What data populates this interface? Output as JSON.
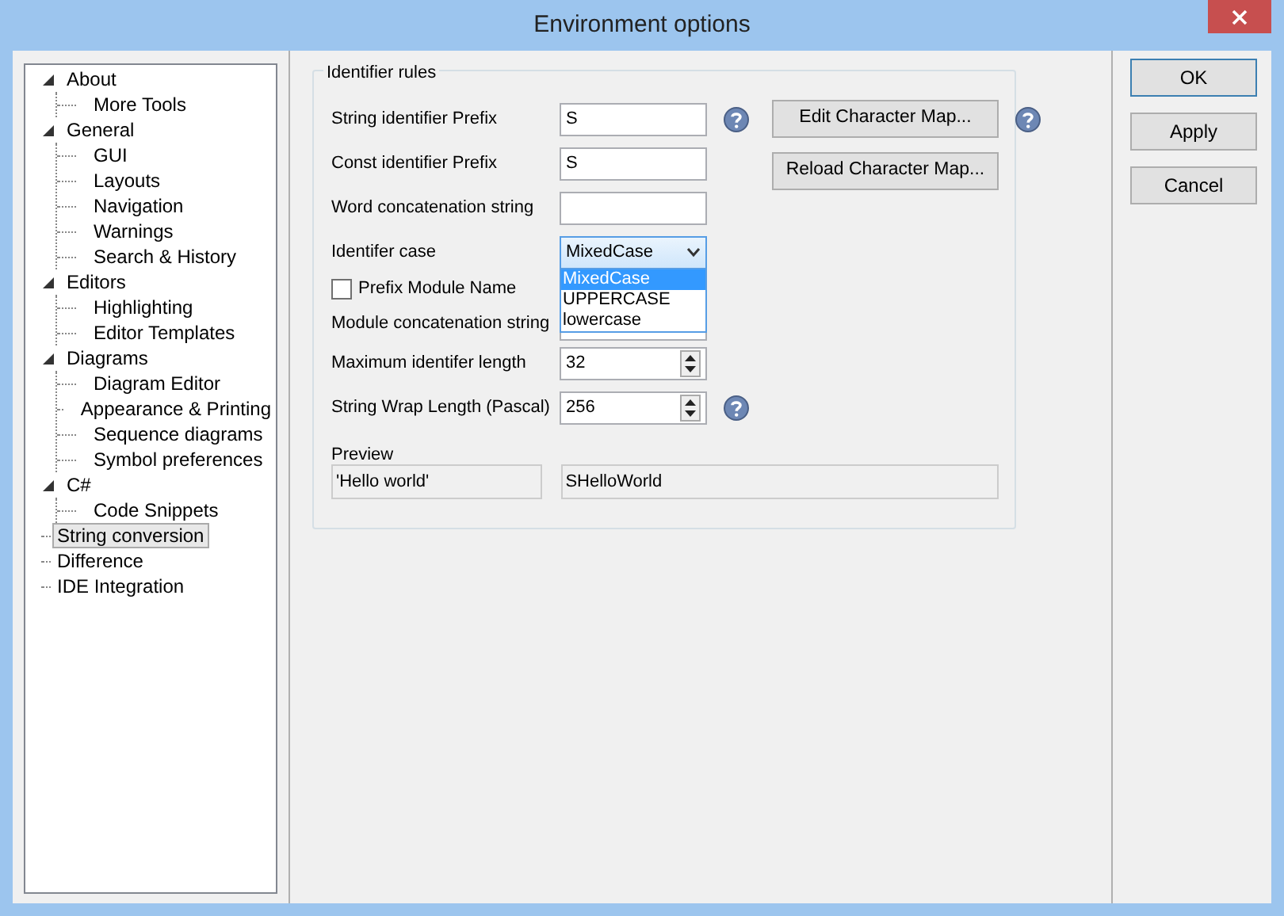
{
  "window": {
    "title": "Environment options"
  },
  "tree": [
    {
      "label": "About",
      "expanded": true,
      "selected": false,
      "children": [
        {
          "label": "More Tools",
          "selected": false
        }
      ]
    },
    {
      "label": "General",
      "expanded": true,
      "selected": false,
      "children": [
        {
          "label": "GUI",
          "selected": false
        },
        {
          "label": "Layouts",
          "selected": false
        },
        {
          "label": "Navigation",
          "selected": false
        },
        {
          "label": "Warnings",
          "selected": false
        },
        {
          "label": "Search & History",
          "selected": false
        }
      ]
    },
    {
      "label": "Editors",
      "expanded": true,
      "selected": false,
      "children": [
        {
          "label": "Highlighting",
          "selected": false
        },
        {
          "label": "Editor Templates",
          "selected": false
        }
      ]
    },
    {
      "label": "Diagrams",
      "expanded": true,
      "selected": false,
      "children": [
        {
          "label": "Diagram Editor",
          "selected": false
        },
        {
          "label": "Appearance & Printing",
          "selected": false
        },
        {
          "label": "Sequence diagrams",
          "selected": false
        },
        {
          "label": "Symbol preferences",
          "selected": false
        }
      ]
    },
    {
      "label": "C#",
      "expanded": true,
      "selected": false,
      "children": [
        {
          "label": "Code Snippets",
          "selected": false
        }
      ]
    },
    {
      "label": "String conversion",
      "selected": true
    },
    {
      "label": "Difference",
      "selected": false
    },
    {
      "label": "IDE Integration",
      "selected": false
    }
  ],
  "group": {
    "title": "Identifier rules",
    "rows": [
      {
        "kind": "text",
        "label": "String identifier Prefix",
        "value": "S",
        "help": true
      },
      {
        "kind": "text",
        "label": "Const identifier Prefix",
        "value": "S",
        "help": false
      },
      {
        "kind": "text",
        "label": "Word concatenation string",
        "help": false
      },
      {
        "kind": "combo",
        "label": "Identifer case",
        "value": "MixedCase",
        "expanded": true,
        "options": [
          {
            "label": "MixedCase",
            "selected": true
          },
          {
            "label": "UPPERCASE",
            "selected": false
          },
          {
            "label": "lowercase",
            "selected": false
          }
        ]
      },
      {
        "kind": "checkbox",
        "label": "Prefix Module Name",
        "checked": false
      },
      {
        "kind": "text",
        "label": "Module concatenation string",
        "help": false
      },
      {
        "kind": "spinner",
        "label": "Maximum identifer length",
        "value": "32",
        "help": false
      },
      {
        "kind": "spinner",
        "label": "String Wrap Length (Pascal)",
        "value": "256",
        "help": true
      }
    ],
    "side_buttons": [
      {
        "label": "Edit Character Map...",
        "help": true
      },
      {
        "label": "Reload Character Map...",
        "help": false
      }
    ],
    "preview": {
      "label": "Preview",
      "input": "'Hello world'",
      "output": "SHelloWorld"
    }
  },
  "buttons": [
    {
      "label": "OK",
      "default": true
    },
    {
      "label": "Apply",
      "default": false
    },
    {
      "label": "Cancel",
      "default": false
    }
  ]
}
